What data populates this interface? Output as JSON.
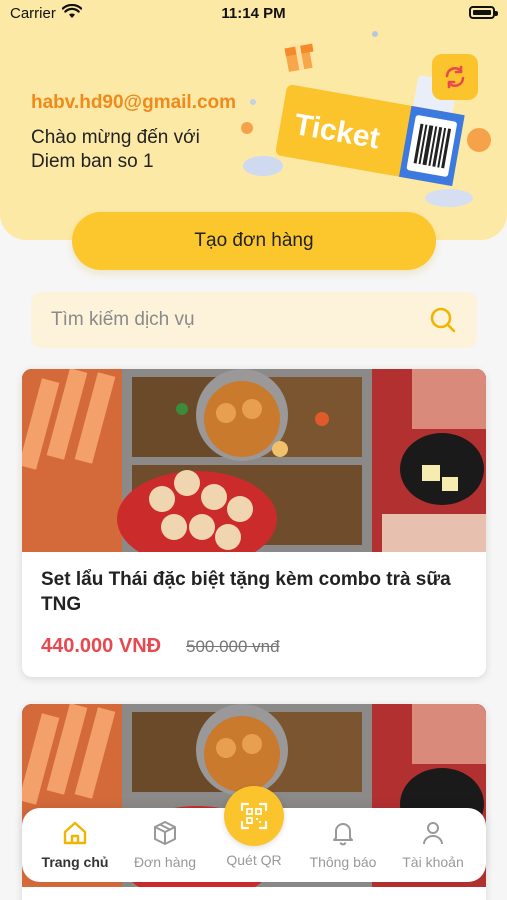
{
  "status": {
    "carrier": "Carrier",
    "time": "11:14 PM"
  },
  "header": {
    "email": "habv.hd90@gmail.com",
    "welcome_line1": "Chào mừng đến với",
    "welcome_line2": "Diem ban so 1",
    "illustration_text": "Ticket"
  },
  "actions": {
    "create_order": "Tạo đơn hàng"
  },
  "search": {
    "placeholder": "Tìm kiếm dịch vụ"
  },
  "products": [
    {
      "title": "Set lẩu Thái đặc biệt tặng kèm combo trà sữa TNG",
      "price": "440.000 VNĐ",
      "old_price": "500.000 vnđ"
    },
    {
      "title": "",
      "price": "",
      "old_price": ""
    }
  ],
  "nav": {
    "items": [
      {
        "label": "Trang chủ",
        "icon": "home-icon",
        "active": true
      },
      {
        "label": "Đơn hàng",
        "icon": "box-icon",
        "active": false
      },
      {
        "label": "Quét QR",
        "icon": "qr-scan-icon",
        "active": false
      },
      {
        "label": "Thông báo",
        "icon": "bell-icon",
        "active": false
      },
      {
        "label": "Tài khoản",
        "icon": "user-icon",
        "active": false
      }
    ]
  },
  "colors": {
    "accent": "#fcc42c",
    "header_bg": "#fde9a6",
    "email": "#f08a1c",
    "price": "#e8484f"
  }
}
